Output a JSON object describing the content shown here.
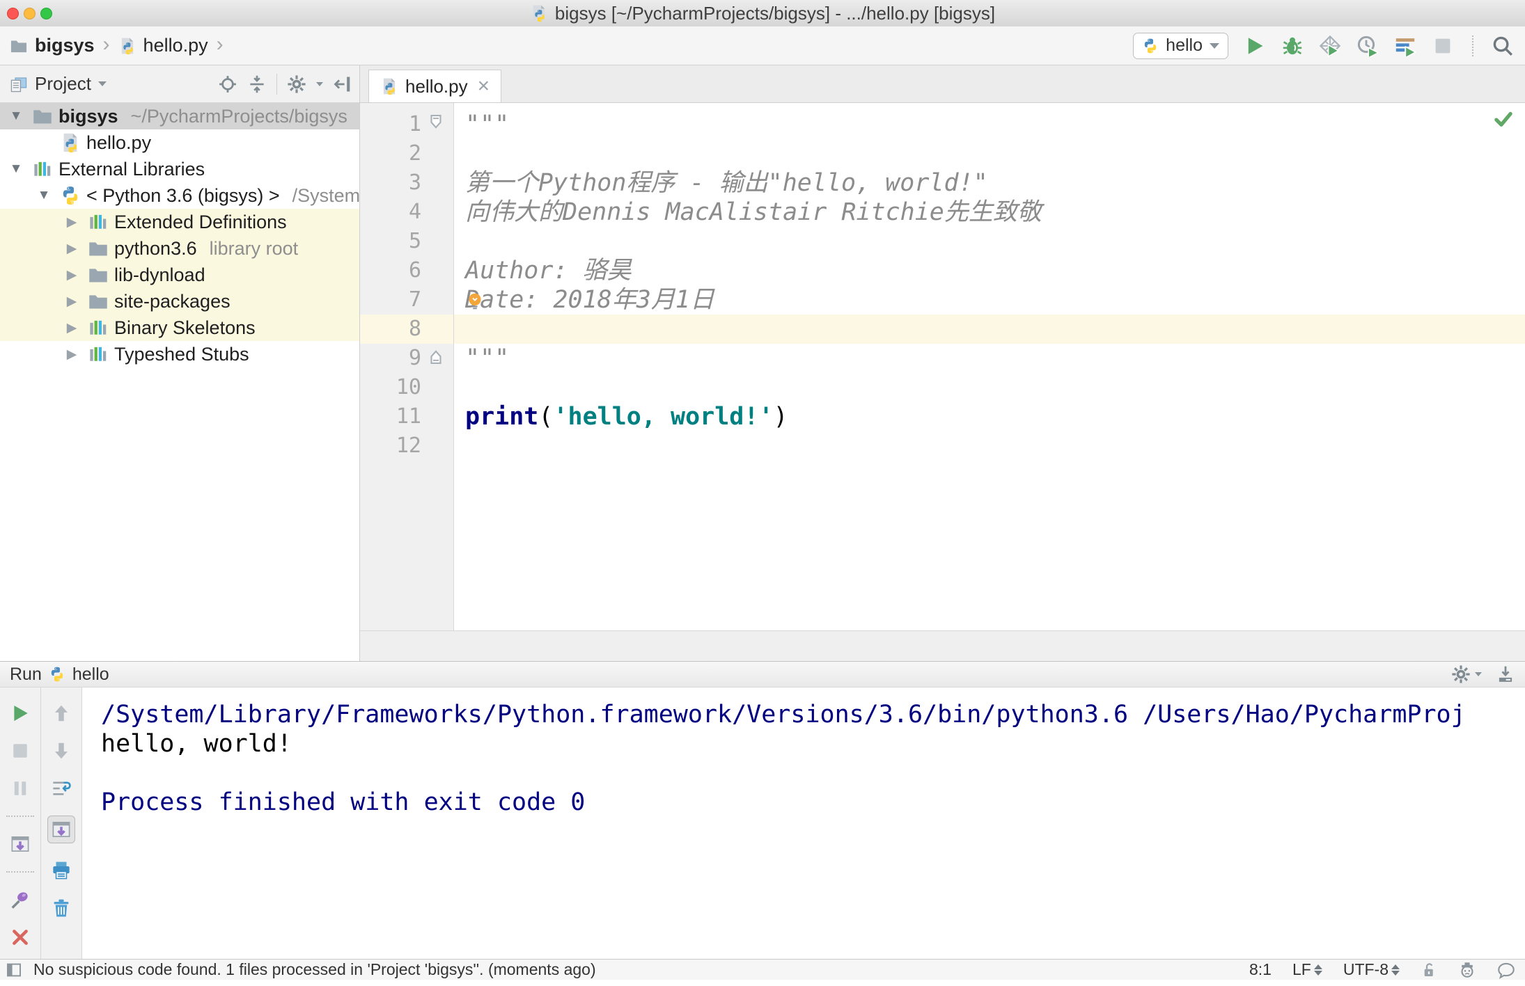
{
  "title_bar": {
    "title": "bigsys [~/PycharmProjects/bigsys] - .../hello.py [bigsys]"
  },
  "nav_bar": {
    "breadcrumbs": [
      {
        "label": "bigsys",
        "icon": "folder"
      },
      {
        "label": "hello.py",
        "icon": "python-file"
      }
    ],
    "run_config": "hello",
    "toolbar_icons": [
      "run",
      "debug",
      "run-with-coverage",
      "profiler",
      "concurrency-diagram",
      "stop",
      "search"
    ]
  },
  "project_panel": {
    "header": {
      "title": "Project",
      "icons": [
        "locate",
        "collapse-all",
        "settings",
        "hide-panel"
      ]
    },
    "tree": [
      {
        "label": "bigsys",
        "hint": "~/PycharmProjects/bigsys",
        "icon": "folder",
        "arrow": "expanded",
        "level": 0,
        "selected": true,
        "bold": true,
        "highlight": false
      },
      {
        "label": "hello.py",
        "icon": "python-file",
        "arrow": "none",
        "level": 1,
        "selected": false,
        "bold": false,
        "highlight": false
      },
      {
        "label": "External Libraries",
        "icon": "library",
        "arrow": "expanded",
        "level": 0,
        "selected": false,
        "bold": false,
        "highlight": false
      },
      {
        "label": "< Python 3.6 (bigsys) >",
        "hint": "/System",
        "icon": "python",
        "arrow": "expanded",
        "level": 1,
        "selected": false,
        "bold": false,
        "highlight": false
      },
      {
        "label": "Extended Definitions",
        "icon": "library",
        "arrow": "collapsed",
        "level": 2,
        "selected": false,
        "bold": false,
        "highlight": true
      },
      {
        "label": "python3.6",
        "hint": "library root",
        "icon": "folder",
        "arrow": "collapsed",
        "level": 2,
        "selected": false,
        "bold": false,
        "highlight": true
      },
      {
        "label": "lib-dynload",
        "icon": "folder",
        "arrow": "collapsed",
        "level": 2,
        "selected": false,
        "bold": false,
        "highlight": true
      },
      {
        "label": "site-packages",
        "icon": "folder",
        "arrow": "collapsed",
        "level": 2,
        "selected": false,
        "bold": false,
        "highlight": true
      },
      {
        "label": "Binary Skeletons",
        "icon": "library",
        "arrow": "collapsed",
        "level": 2,
        "selected": false,
        "bold": false,
        "highlight": true
      },
      {
        "label": "Typeshed Stubs",
        "icon": "library",
        "arrow": "collapsed",
        "level": 2,
        "selected": false,
        "bold": false,
        "highlight": false
      }
    ]
  },
  "editor": {
    "tab": {
      "label": "hello.py"
    },
    "inspection_status": "no-problems-checkmark",
    "lines": [
      {
        "n": 1,
        "current": false,
        "segments": [
          {
            "text": "\"\"\"",
            "type": "docstring"
          }
        ]
      },
      {
        "n": 2,
        "current": false,
        "segments": []
      },
      {
        "n": 3,
        "current": false,
        "segments": [
          {
            "text": "第一个Python程序 - 输出\"hello, world!\"",
            "type": "docstring"
          }
        ]
      },
      {
        "n": 4,
        "current": false,
        "segments": [
          {
            "text": "向伟大的Dennis MacAlistair Ritchie先生致敬",
            "type": "docstring"
          }
        ]
      },
      {
        "n": 5,
        "current": false,
        "segments": []
      },
      {
        "n": 6,
        "current": false,
        "segments": [
          {
            "text": "Author: 骆昊",
            "type": "docstring"
          }
        ]
      },
      {
        "n": 7,
        "current": false,
        "segments": [
          {
            "text": "Date: 2018年3月1日",
            "type": "docstring"
          }
        ]
      },
      {
        "n": 8,
        "current": true,
        "segments": []
      },
      {
        "n": 9,
        "current": false,
        "segments": [
          {
            "text": "\"\"\"",
            "type": "docstring"
          }
        ]
      },
      {
        "n": 10,
        "current": false,
        "segments": []
      },
      {
        "n": 11,
        "current": false,
        "segments": [
          {
            "text": "print",
            "type": "keyword"
          },
          {
            "text": "(",
            "type": "plain"
          },
          {
            "text": "'hello, world!'",
            "type": "string"
          },
          {
            "text": ")",
            "type": "plain"
          }
        ]
      },
      {
        "n": 12,
        "current": false,
        "segments": []
      }
    ]
  },
  "run_panel": {
    "title": "Run",
    "config": "hello",
    "header_icons": [
      "settings",
      "dock"
    ],
    "toolbar": {
      "left_icons": [
        "rerun",
        "stop",
        "pause",
        "restore-layout",
        "pin",
        "close",
        "more"
      ],
      "right_icons": [
        "up",
        "down",
        "soft-wraps",
        "scroll-to-end",
        "print",
        "clear-all"
      ]
    },
    "console": {
      "lines": [
        {
          "text": "/System/Library/Frameworks/Python.framework/Versions/3.6/bin/python3.6 /Users/Hao/PycharmProj",
          "color": "system"
        },
        {
          "text": "hello, world!",
          "color": "stdout"
        },
        {
          "text": "",
          "color": "stdout"
        },
        {
          "text": "Process finished with exit code 0",
          "color": "system"
        }
      ]
    }
  },
  "status_bar": {
    "message": "No suspicious code found. 1 files processed in 'Project 'bigsys''. (moments ago)",
    "position": "8:1",
    "line_separator": "LF",
    "encoding": "UTF-8",
    "icons": [
      "toolwindows",
      "unlock",
      "inspections-profile",
      "notifications"
    ]
  },
  "colors": {
    "accent_green": "#59A869",
    "keyword": "#000080",
    "string": "#008080",
    "docstring": "#8C8C8C",
    "console_system": "#000080",
    "caret_line": "#FCF8E3",
    "library_row_highlight": "#FAF8DF",
    "tree_selection": "#D4D4D4"
  }
}
